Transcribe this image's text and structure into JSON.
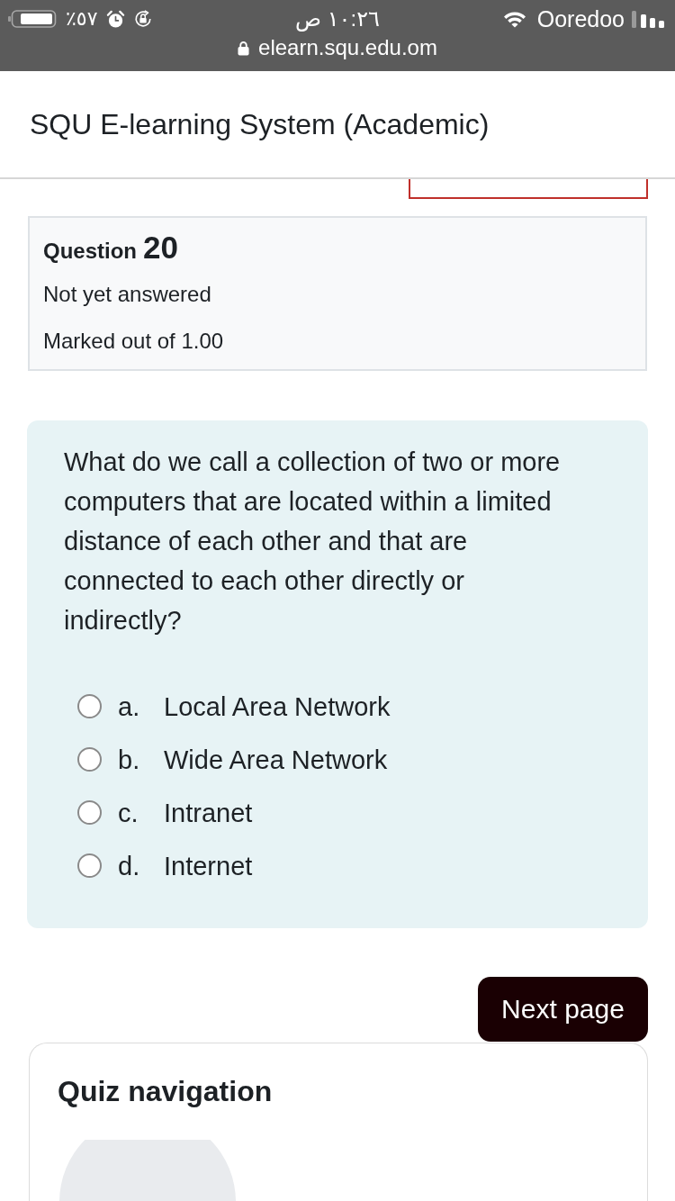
{
  "status_bar": {
    "battery": "٪٥٧",
    "time": "١٠:٢٦ ص",
    "carrier": "Ooredoo",
    "url": "elearn.squ.edu.om"
  },
  "header": {
    "title": "SQU E-learning System (Academic)"
  },
  "question_info": {
    "label": "Question",
    "number": "20",
    "state": "Not yet answered",
    "grade": "Marked out of 1.00"
  },
  "question": {
    "text": "What do we call a collection of two or more computers that are located within a limited distance of each other and that are connected to each other directly or indirectly?",
    "options": [
      {
        "letter": "a.",
        "label": "Local Area Network",
        "selected": false
      },
      {
        "letter": "b.",
        "label": "Wide Area Network",
        "selected": false
      },
      {
        "letter": "c.",
        "label": "Intranet",
        "selected": false
      },
      {
        "letter": "d.",
        "label": "Internet",
        "selected": false
      }
    ]
  },
  "next_button": {
    "label": "Next page"
  },
  "quiz_navigation": {
    "title": "Quiz navigation"
  }
}
